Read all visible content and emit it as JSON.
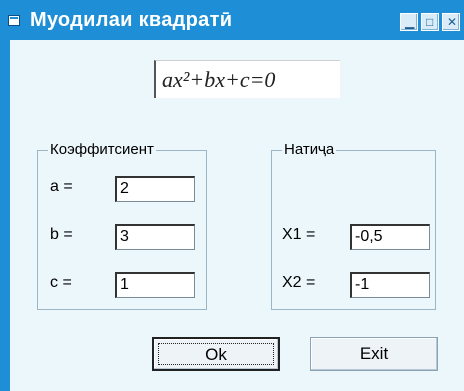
{
  "window": {
    "title": "Муодилаи квадратӣ",
    "formula": "ax²+bx+c=0",
    "title_color": "#1e8fd6",
    "client_bg": "#ecf7fc"
  },
  "coefficients": {
    "label": "Коэффитсиент",
    "a_label": "a =",
    "a_value": "2",
    "b_label": "b =",
    "b_value": "3",
    "c_label": "c =",
    "c_value": "1"
  },
  "result": {
    "label": "Натиҷа",
    "x1_label": "X1 =",
    "x1_value": "-0,5",
    "x2_label": "X2 =",
    "x2_value": "-1"
  },
  "buttons": {
    "ok_label": "Ok",
    "exit_label": "Exit"
  }
}
